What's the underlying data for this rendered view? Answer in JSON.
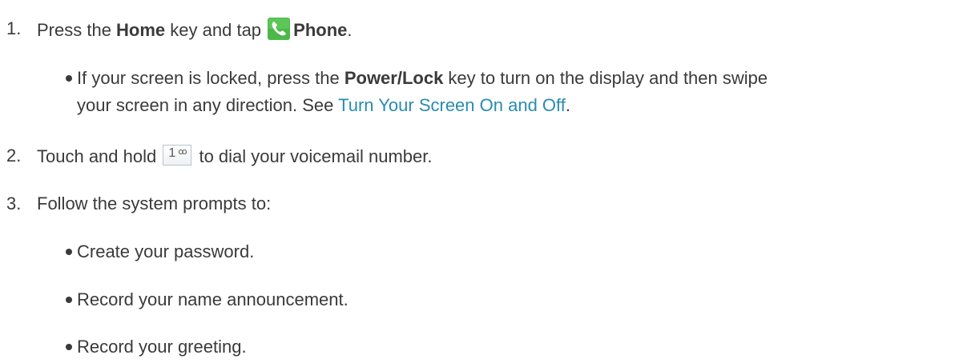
{
  "steps": [
    {
      "number": "1.",
      "parts": {
        "a": "Press the ",
        "b": "Home",
        "c": " key and tap ",
        "d": "Phone",
        "e": "."
      },
      "icon": "phone-icon",
      "bullets": [
        {
          "a": "If your screen is locked, press the ",
          "b": "Power/Lock",
          "c": " key to turn on the display and then swipe",
          "d": "your screen in any direction. See ",
          "link": "Turn Your Screen On and Off",
          "e": "."
        }
      ]
    },
    {
      "number": "2.",
      "parts": {
        "a": "Touch and hold ",
        "key_digit": "1",
        "key_symbol": "ꝏ",
        "b": " to dial your voicemail number."
      },
      "icon": "voicemail-key-icon"
    },
    {
      "number": "3.",
      "text": "Follow the system prompts to:",
      "bullets": [
        "Create your password.",
        "Record your name announcement.",
        "Record your greeting."
      ]
    }
  ],
  "colors": {
    "text": "#3a3a3a",
    "link": "#2a8bb0",
    "phone_icon_bg": "#4cb848"
  }
}
